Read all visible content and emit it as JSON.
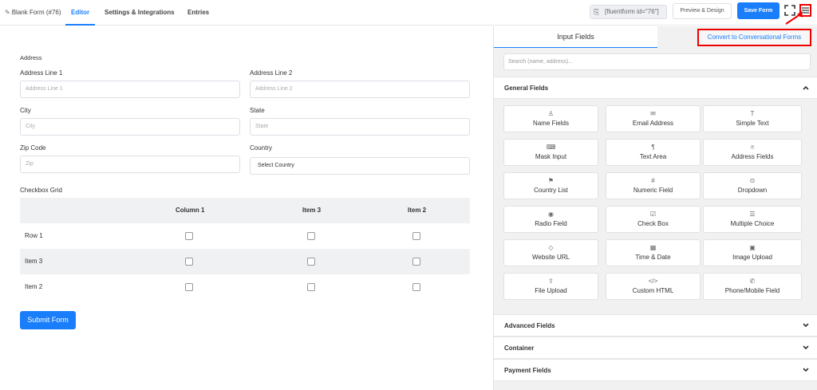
{
  "topbar": {
    "tabs": [
      {
        "label": "Blank Form (#76)",
        "icon": "edit-icon"
      },
      {
        "label": "Editor"
      },
      {
        "label": "Settings & Integrations"
      },
      {
        "label": "Entries"
      }
    ],
    "shortcode": "[fluentform id=\"76\"]",
    "preview_label": "Preview & Design",
    "save_label": "Save Form"
  },
  "form": {
    "address_title": "Address",
    "address_line1_label": "Address Line 1",
    "address_line1_placeholder": "Address Line 1",
    "address_line2_label": "Address Line 2",
    "address_line2_placeholder": "Address Line 2",
    "city_label": "City",
    "city_placeholder": "City",
    "state_label": "State",
    "state_placeholder": "State",
    "zip_label": "Zip Code",
    "zip_placeholder": "Zip",
    "country_label": "Country",
    "country_value": "Select Country",
    "grid_label": "Checkbox Grid",
    "grid_columns": [
      "Column 1",
      "Item 3",
      "Item 2"
    ],
    "grid_rows": [
      "Row 1",
      "Item 3",
      "Item 2"
    ],
    "submit_label": "Submit Form"
  },
  "panel": {
    "tab_input": "Input Fields",
    "tab_convert": "Convert to Conversational Forms",
    "search_placeholder": "Search (name, address)...",
    "general_title": "General Fields",
    "fields": [
      {
        "label": "Name Fields",
        "icon": "person-icon",
        "glyph": "♙"
      },
      {
        "label": "Email Address",
        "icon": "envelope-icon",
        "glyph": "✉"
      },
      {
        "label": "Simple Text",
        "icon": "text-icon",
        "glyph": "T"
      },
      {
        "label": "Mask Input",
        "icon": "keyboard-icon",
        "glyph": "⌨"
      },
      {
        "label": "Text Area",
        "icon": "paragraph-icon",
        "glyph": "¶"
      },
      {
        "label": "Address Fields",
        "icon": "location-icon",
        "glyph": "⌾"
      },
      {
        "label": "Country List",
        "icon": "flag-icon",
        "glyph": "⚑"
      },
      {
        "label": "Numeric Field",
        "icon": "hash-icon",
        "glyph": "#"
      },
      {
        "label": "Dropdown",
        "icon": "chevron-circle-icon",
        "glyph": "⊙"
      },
      {
        "label": "Radio Field",
        "icon": "radio-icon",
        "glyph": "◉"
      },
      {
        "label": "Check Box",
        "icon": "checkbox-icon",
        "glyph": "☑"
      },
      {
        "label": "Multiple Choice",
        "icon": "list-icon",
        "glyph": "☰"
      },
      {
        "label": "Website URL",
        "icon": "link-icon",
        "glyph": "◇"
      },
      {
        "label": "Time & Date",
        "icon": "calendar-icon",
        "glyph": "▦"
      },
      {
        "label": "Image Upload",
        "icon": "image-icon",
        "glyph": "▣"
      },
      {
        "label": "File Upload",
        "icon": "upload-icon",
        "glyph": "⇪"
      },
      {
        "label": "Custom HTML",
        "icon": "code-icon",
        "glyph": "</>"
      },
      {
        "label": "Phone/Mobile Field",
        "icon": "phone-icon",
        "glyph": "✆"
      }
    ],
    "sections": [
      "Advanced Fields",
      "Container",
      "Payment Fields"
    ]
  },
  "colors": {
    "accent": "#1a7efb",
    "highlight": "#e00000"
  }
}
